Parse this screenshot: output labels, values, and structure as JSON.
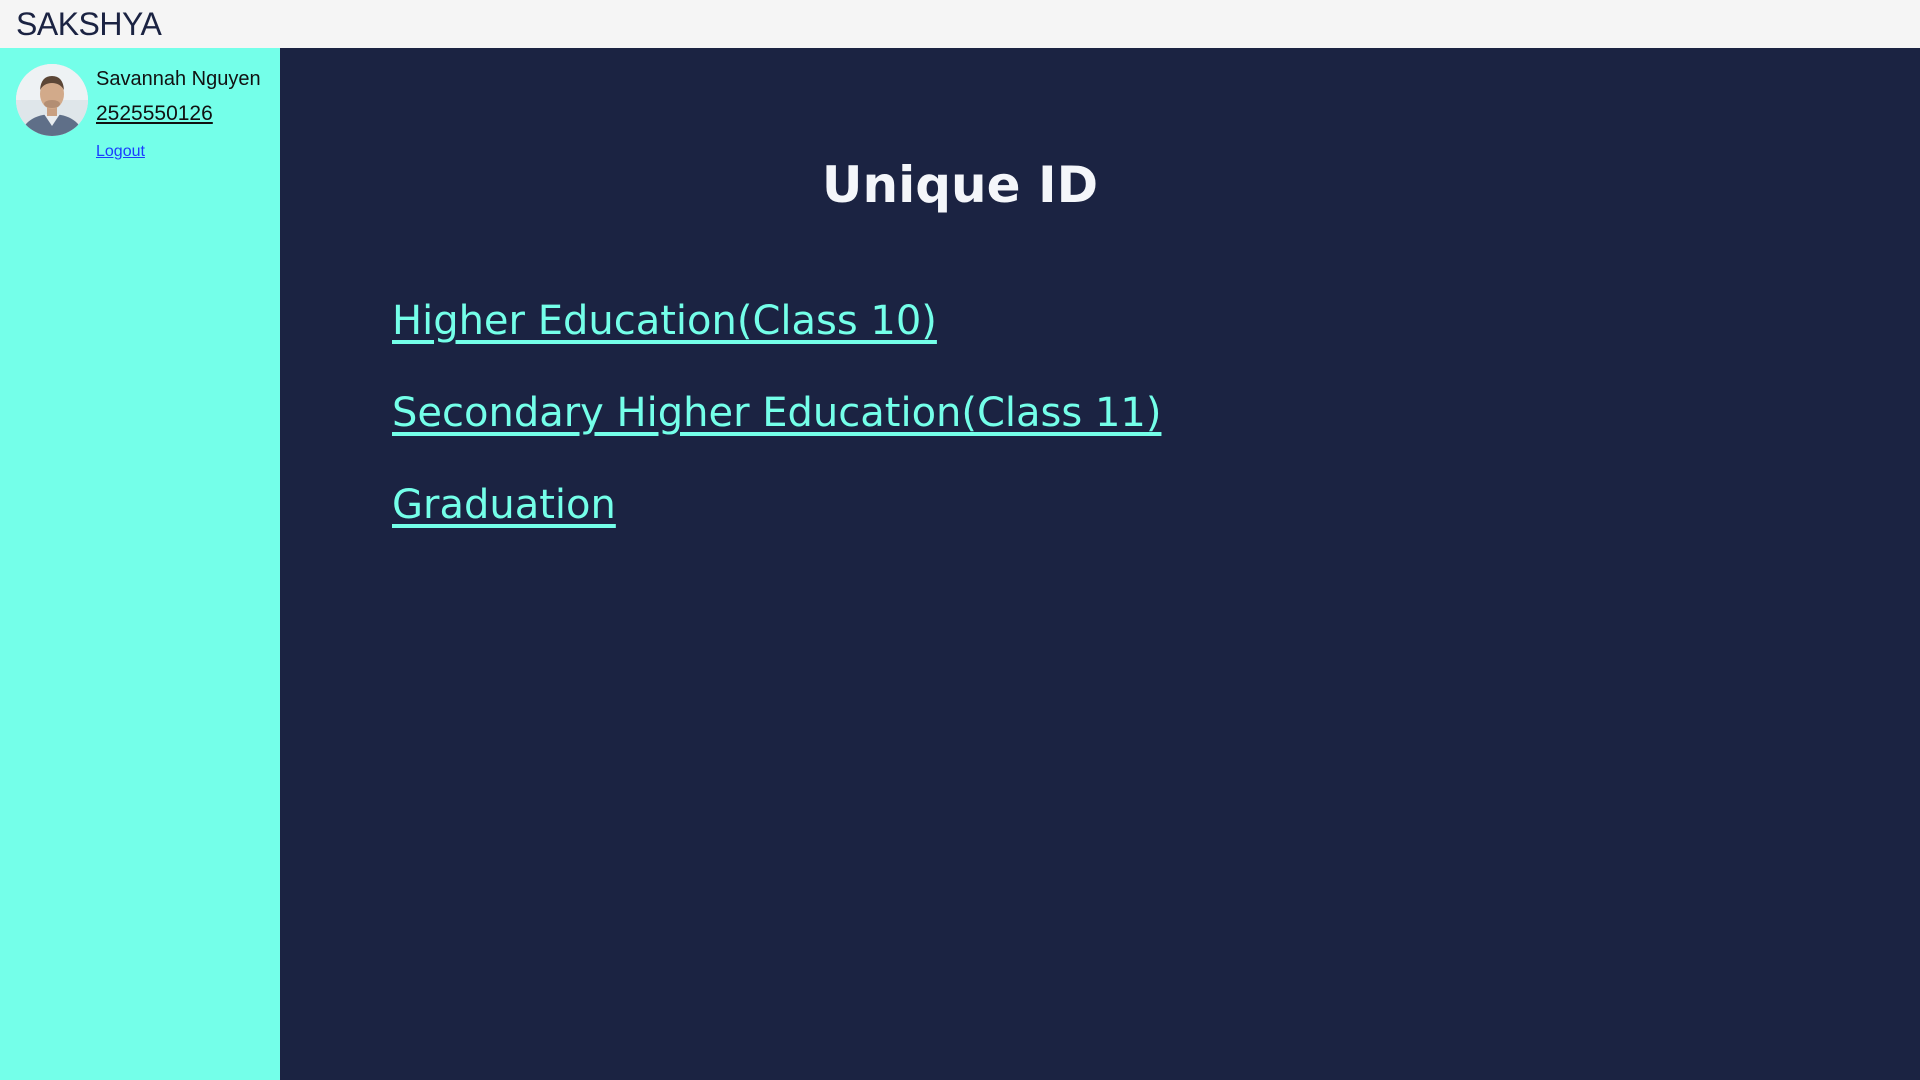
{
  "app": {
    "brand": "SAKSHYA"
  },
  "sidebar": {
    "user": {
      "name": "Savannah Nguyen",
      "phone": "2525550126",
      "avatar_icon": "user-avatar-photo"
    },
    "logout_label": "Logout"
  },
  "main": {
    "title": "Unique ID",
    "links": [
      {
        "label": "Higher Education(Class 10)"
      },
      {
        "label": "Secondary Higher Education(Class 11)"
      },
      {
        "label": "Graduation"
      }
    ]
  },
  "colors": {
    "topbar_bg": "#f5f5f5",
    "sidebar_bg": "#74ffe9",
    "main_bg": "#1b2342",
    "link_color": "#74ffe9",
    "title_color": "#f4f6fa",
    "logout_color": "#1a3cff"
  }
}
